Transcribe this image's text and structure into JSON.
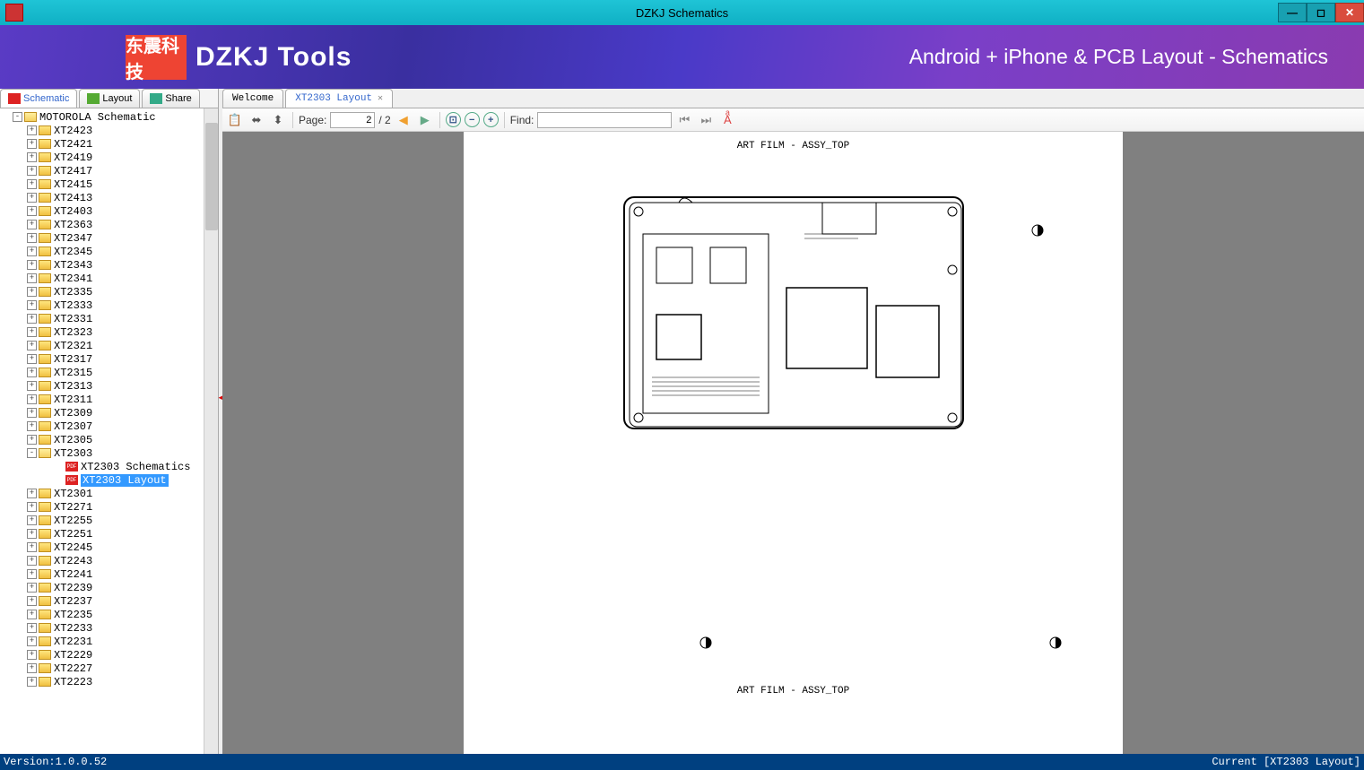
{
  "window": {
    "title": "DZKJ Schematics"
  },
  "banner": {
    "logo": "东震科技",
    "brand": "DZKJ Tools",
    "tagline": "Android + iPhone & PCB Layout - Schematics"
  },
  "side_tabs": [
    {
      "label": "Schematic",
      "icon": "pdf",
      "active": true
    },
    {
      "label": "Layout",
      "icon": "pads",
      "active": false
    },
    {
      "label": "Share",
      "icon": "share",
      "active": false
    }
  ],
  "tree": {
    "root": {
      "label": "MOTOROLA Schematic",
      "expanded": true
    },
    "items": [
      {
        "label": "XT2423"
      },
      {
        "label": "XT2421"
      },
      {
        "label": "XT2419"
      },
      {
        "label": "XT2417"
      },
      {
        "label": "XT2415"
      },
      {
        "label": "XT2413"
      },
      {
        "label": "XT2403"
      },
      {
        "label": "XT2363"
      },
      {
        "label": "XT2347"
      },
      {
        "label": "XT2345"
      },
      {
        "label": "XT2343"
      },
      {
        "label": "XT2341"
      },
      {
        "label": "XT2335"
      },
      {
        "label": "XT2333"
      },
      {
        "label": "XT2331"
      },
      {
        "label": "XT2323"
      },
      {
        "label": "XT2321"
      },
      {
        "label": "XT2317"
      },
      {
        "label": "XT2315"
      },
      {
        "label": "XT2313"
      },
      {
        "label": "XT2311"
      },
      {
        "label": "XT2309"
      },
      {
        "label": "XT2307"
      },
      {
        "label": "XT2305"
      },
      {
        "label": "XT2303",
        "expanded": true,
        "children": [
          {
            "label": "XT2303 Schematics",
            "type": "pdf"
          },
          {
            "label": "XT2303 Layout",
            "type": "pdf",
            "selected": true
          }
        ]
      },
      {
        "label": "XT2301"
      },
      {
        "label": "XT2271"
      },
      {
        "label": "XT2255"
      },
      {
        "label": "XT2251"
      },
      {
        "label": "XT2245"
      },
      {
        "label": "XT2243"
      },
      {
        "label": "XT2241"
      },
      {
        "label": "XT2239"
      },
      {
        "label": "XT2237"
      },
      {
        "label": "XT2235"
      },
      {
        "label": "XT2233"
      },
      {
        "label": "XT2231"
      },
      {
        "label": "XT2229"
      },
      {
        "label": "XT2227"
      },
      {
        "label": "XT2223"
      }
    ]
  },
  "doc_tabs": [
    {
      "label": "Welcome",
      "closable": false,
      "active": false
    },
    {
      "label": "XT2303 Layout",
      "closable": true,
      "active": true
    }
  ],
  "toolbar": {
    "page_label": "Page:",
    "page_current": "2",
    "page_total": "/ 2",
    "find_label": "Find:",
    "find_value": ""
  },
  "document": {
    "header_text": "ART FILM - ASSY_TOP",
    "footer_text": "ART FILM - ASSY_TOP"
  },
  "statusbar": {
    "version": "Version:1.0.0.52",
    "current": "Current [XT2303 Layout]"
  }
}
